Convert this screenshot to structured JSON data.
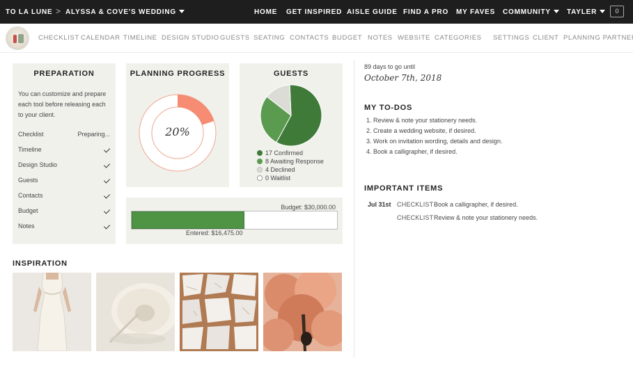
{
  "topbar": {
    "brand": "TO LA LUNE",
    "separator": ">",
    "wedding": "ALYSSA & COVE'S WEDDING",
    "nav": [
      "HOME",
      "GET INSPIRED",
      "AISLE GUIDE",
      "FIND A PRO",
      "MY FAVES",
      "COMMUNITY",
      "TAYLER"
    ],
    "cart_count": "0"
  },
  "subnav": {
    "items": [
      "CHECKLIST",
      "CALENDAR",
      "TIMELINE",
      "DESIGN STUDIO",
      "GUESTS",
      "SEATING",
      "CONTACTS",
      "BUDGET",
      "NOTES",
      "WEBSITE",
      "CATEGORIES"
    ],
    "right_items": [
      "SETTINGS",
      "CLIENT",
      "PLANNING PARTNERS"
    ]
  },
  "preparation": {
    "title": "PREPARATION",
    "description": "You can customize and prepare each tool before releasing each to your client.",
    "rows": [
      {
        "label": "Checklist",
        "status": "Preparing..."
      },
      {
        "label": "Timeline",
        "status": "check"
      },
      {
        "label": "Design Studio",
        "status": "check"
      },
      {
        "label": "Guests",
        "status": "check"
      },
      {
        "label": "Contacts",
        "status": "check"
      },
      {
        "label": "Budget",
        "status": "check"
      },
      {
        "label": "Notes",
        "status": "check"
      }
    ]
  },
  "planning_progress": {
    "title": "PLANNING PROGRESS",
    "percent_label": "20%",
    "percent": 20,
    "color": "#f58c73"
  },
  "guests": {
    "title": "GUESTS",
    "legend": [
      {
        "label": "17 Confirmed",
        "count": 17,
        "color": "#3f7a38"
      },
      {
        "label": "8 Awaiting Response",
        "count": 8,
        "color": "#5b9b4f"
      },
      {
        "label": "4 Declined",
        "count": 4,
        "color": "#dcdcd6"
      },
      {
        "label": "0 Waitlist",
        "count": 0,
        "color": "#ffffff"
      }
    ]
  },
  "budget": {
    "budget_label": "Budget: $30,000.00",
    "entered_label": "Entered: $16,475.00",
    "fraction": 0.549
  },
  "inspiration": {
    "title": "INSPIRATION",
    "images": [
      "white-dress-image",
      "pampas-bowl-image",
      "marble-gold-image",
      "peach-flower-image"
    ]
  },
  "countdown": {
    "days_text": "89 days to go until",
    "date": "October 7th, 2018"
  },
  "todos": {
    "title": "MY TO-DOS",
    "items": [
      "1. Review & note your stationery needs.",
      "2. Create a wedding website, if desired.",
      "3. Work on invitation wording, details and design.",
      "4. Book a calligrapher, if desired."
    ]
  },
  "important": {
    "title": "IMPORTANT ITEMS",
    "items": [
      {
        "date": "Jul 31st",
        "category": "CHECKLIST",
        "text": "Book a calligrapher, if desired."
      },
      {
        "date": "",
        "category": "CHECKLIST",
        "text": "Review & note your stationery needs."
      }
    ]
  }
}
